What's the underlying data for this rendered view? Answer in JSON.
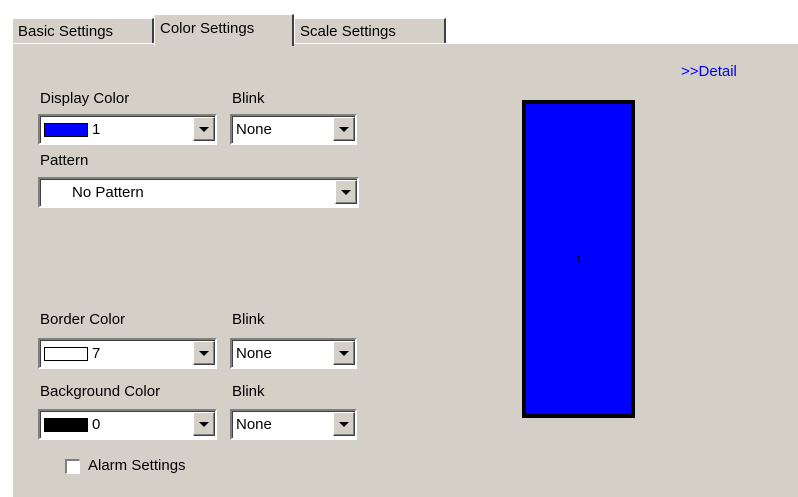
{
  "tabs": [
    {
      "label": "Basic Settings",
      "active": false
    },
    {
      "label": "Color Settings",
      "active": true
    },
    {
      "label": "Scale Settings",
      "active": false
    }
  ],
  "detail_link": ">>Detail",
  "display_color": {
    "label": "Display Color",
    "value": "1",
    "swatch": "#0000ff"
  },
  "display_blink": {
    "label": "Blink",
    "value": "None"
  },
  "pattern": {
    "label": "Pattern",
    "value": "No Pattern"
  },
  "border_color": {
    "label": "Border Color",
    "value": "7",
    "swatch": "#ffffff"
  },
  "border_blink": {
    "label": "Blink",
    "value": "None"
  },
  "background_color": {
    "label": "Background Color",
    "value": "0",
    "swatch": "#000000"
  },
  "background_blink": {
    "label": "Blink",
    "value": "None"
  },
  "alarm": {
    "label": "Alarm Settings",
    "checked": false
  },
  "preview": {
    "fill": "#0000ff",
    "border": "#000000",
    "center_text": "1"
  },
  "colors": {
    "panel": "#d4d0c8",
    "link": "#0000ff"
  }
}
